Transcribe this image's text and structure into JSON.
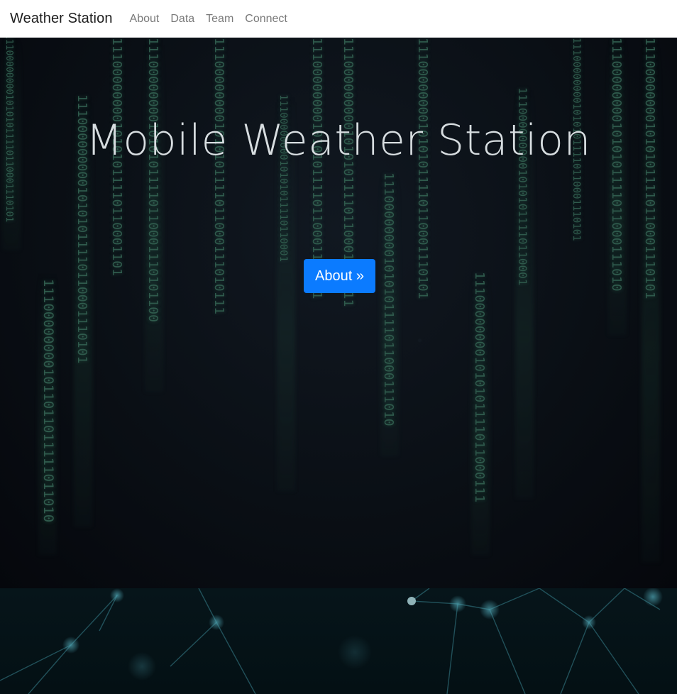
{
  "navbar": {
    "brand": "Weather Station",
    "links": [
      "About",
      "Data",
      "Team",
      "Connect"
    ]
  },
  "hero": {
    "title": "Mobile Weather Station",
    "button_label": "About »",
    "binary_columns": [
      "1110000000010101011110110001110101",
      "111000000001011011011111011010",
      "11100000000010101011110110001110101",
      "1110000000010101011110110001101",
      "1110000000010101011110110001110101100",
      "111000000001010101111011000111010111",
      "1110000000010101011110110001",
      "1110000000010101011110110001110101",
      "11100000000010101011110110001101011",
      "111000000001010101111011000111010",
      "1110000000010101011110110001110101",
      "111000000001010101111011000111",
      "11100000000010101011110110001",
      "1110000000010101011110110001110101",
      "111000000001010101111011000111010",
      "1110000000010101011110110001110101",
      "11100000000010101011110110001110101"
    ]
  },
  "colors": {
    "accent": "#0b7bff",
    "hero_text": "#d7dde0",
    "binary": "#2f5a4c"
  }
}
